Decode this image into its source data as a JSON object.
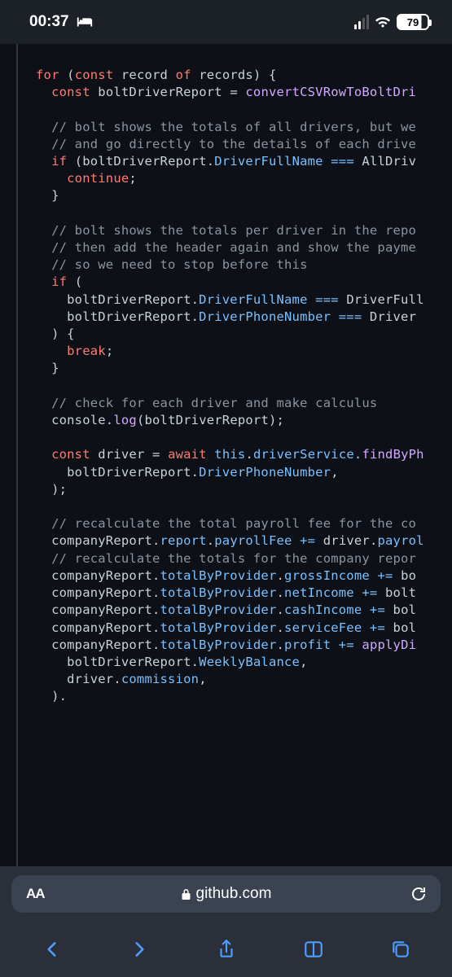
{
  "status": {
    "time": "00:37",
    "battery": "79"
  },
  "browser": {
    "textSize": "AA",
    "host": "github.com"
  },
  "code": {
    "lines": [
      [
        [
          "k-for",
          "for"
        ],
        [
          "ident",
          " ("
        ],
        [
          "k-const",
          "const"
        ],
        [
          "ident",
          " record "
        ],
        [
          "k-of",
          "of"
        ],
        [
          "ident",
          " records) {"
        ]
      ],
      [
        [
          "ident",
          "  "
        ],
        [
          "k-const",
          "const"
        ],
        [
          "ident",
          " boltDriverReport = "
        ],
        [
          "func",
          "convertCSVRowToBoltDri"
        ]
      ],
      [],
      [
        [
          "ident",
          "  "
        ],
        [
          "comment",
          "// bolt shows the totals of all drivers, but we"
        ]
      ],
      [
        [
          "ident",
          "  "
        ],
        [
          "comment",
          "// and go directly to the details of each drive"
        ]
      ],
      [
        [
          "ident",
          "  "
        ],
        [
          "k-if",
          "if"
        ],
        [
          "ident",
          " (boltDriverReport."
        ],
        [
          "prop",
          "DriverFullName"
        ],
        [
          "ident",
          " "
        ],
        [
          "op",
          "==="
        ],
        [
          "ident",
          " AllDriv"
        ]
      ],
      [
        [
          "ident",
          "    "
        ],
        [
          "k-flow",
          "continue"
        ],
        [
          "ident",
          ";"
        ]
      ],
      [
        [
          "ident",
          "  }"
        ]
      ],
      [],
      [
        [
          "ident",
          "  "
        ],
        [
          "comment",
          "// bolt shows the totals per driver in the repo"
        ]
      ],
      [
        [
          "ident",
          "  "
        ],
        [
          "comment",
          "// then add the header again and show the payme"
        ]
      ],
      [
        [
          "ident",
          "  "
        ],
        [
          "comment",
          "// so we need to stop before this"
        ]
      ],
      [
        [
          "ident",
          "  "
        ],
        [
          "k-if",
          "if"
        ],
        [
          "ident",
          " ("
        ]
      ],
      [
        [
          "ident",
          "    boltDriverReport."
        ],
        [
          "prop",
          "DriverFullName"
        ],
        [
          "ident",
          " "
        ],
        [
          "op",
          "==="
        ],
        [
          "ident",
          " DriverFull"
        ]
      ],
      [
        [
          "ident",
          "    boltDriverReport."
        ],
        [
          "prop",
          "DriverPhoneNumber"
        ],
        [
          "ident",
          " "
        ],
        [
          "op",
          "==="
        ],
        [
          "ident",
          " Driver"
        ]
      ],
      [
        [
          "ident",
          "  ) {"
        ]
      ],
      [
        [
          "ident",
          "    "
        ],
        [
          "k-flow",
          "break"
        ],
        [
          "ident",
          ";"
        ]
      ],
      [
        [
          "ident",
          "  }"
        ]
      ],
      [],
      [
        [
          "ident",
          "  "
        ],
        [
          "comment",
          "// check for each driver and make calculus"
        ]
      ],
      [
        [
          "ident",
          "  console."
        ],
        [
          "func",
          "log"
        ],
        [
          "ident",
          "(boltDriverReport);"
        ]
      ],
      [],
      [
        [
          "ident",
          "  "
        ],
        [
          "k-const",
          "const"
        ],
        [
          "ident",
          " driver = "
        ],
        [
          "k-await",
          "await"
        ],
        [
          "ident",
          " "
        ],
        [
          "k-this",
          "this"
        ],
        [
          "ident",
          "."
        ],
        [
          "prop",
          "driverService"
        ],
        [
          "ident",
          "."
        ],
        [
          "func",
          "findByPh"
        ]
      ],
      [
        [
          "ident",
          "    boltDriverReport."
        ],
        [
          "prop",
          "DriverPhoneNumber"
        ],
        [
          "ident",
          ","
        ]
      ],
      [
        [
          "ident",
          "  );"
        ]
      ],
      [],
      [
        [
          "ident",
          "  "
        ],
        [
          "comment",
          "// recalculate the total payroll fee for the co"
        ]
      ],
      [
        [
          "ident",
          "  companyReport."
        ],
        [
          "prop",
          "report"
        ],
        [
          "ident",
          "."
        ],
        [
          "prop",
          "payrollFee"
        ],
        [
          "ident",
          " "
        ],
        [
          "op",
          "+="
        ],
        [
          "ident",
          " driver."
        ],
        [
          "prop",
          "payrol"
        ]
      ],
      [
        [
          "ident",
          "  "
        ],
        [
          "comment",
          "// recalculate the totals for the company repor"
        ]
      ],
      [
        [
          "ident",
          "  companyReport."
        ],
        [
          "prop",
          "totalByProvider"
        ],
        [
          "ident",
          "."
        ],
        [
          "prop",
          "grossIncome"
        ],
        [
          "ident",
          " "
        ],
        [
          "op",
          "+="
        ],
        [
          "ident",
          " bo"
        ]
      ],
      [
        [
          "ident",
          "  companyReport."
        ],
        [
          "prop",
          "totalByProvider"
        ],
        [
          "ident",
          "."
        ],
        [
          "prop",
          "netIncome"
        ],
        [
          "ident",
          " "
        ],
        [
          "op",
          "+="
        ],
        [
          "ident",
          " bolt"
        ]
      ],
      [
        [
          "ident",
          "  companyReport."
        ],
        [
          "prop",
          "totalByProvider"
        ],
        [
          "ident",
          "."
        ],
        [
          "prop",
          "cashIncome"
        ],
        [
          "ident",
          " "
        ],
        [
          "op",
          "+="
        ],
        [
          "ident",
          " bol"
        ]
      ],
      [
        [
          "ident",
          "  companyReport."
        ],
        [
          "prop",
          "totalByProvider"
        ],
        [
          "ident",
          "."
        ],
        [
          "prop",
          "serviceFee"
        ],
        [
          "ident",
          " "
        ],
        [
          "op",
          "+="
        ],
        [
          "ident",
          " bol"
        ]
      ],
      [
        [
          "ident",
          "  companyReport."
        ],
        [
          "prop",
          "totalByProvider"
        ],
        [
          "ident",
          "."
        ],
        [
          "prop",
          "profit"
        ],
        [
          "ident",
          " "
        ],
        [
          "op",
          "+="
        ],
        [
          "ident",
          " "
        ],
        [
          "func",
          "applyDi"
        ]
      ],
      [
        [
          "ident",
          "    boltDriverReport."
        ],
        [
          "prop",
          "WeeklyBalance"
        ],
        [
          "ident",
          ","
        ]
      ],
      [
        [
          "ident",
          "    driver."
        ],
        [
          "prop",
          "commission"
        ],
        [
          "ident",
          ","
        ]
      ],
      [
        [
          "ident",
          "  )."
        ]
      ]
    ]
  }
}
